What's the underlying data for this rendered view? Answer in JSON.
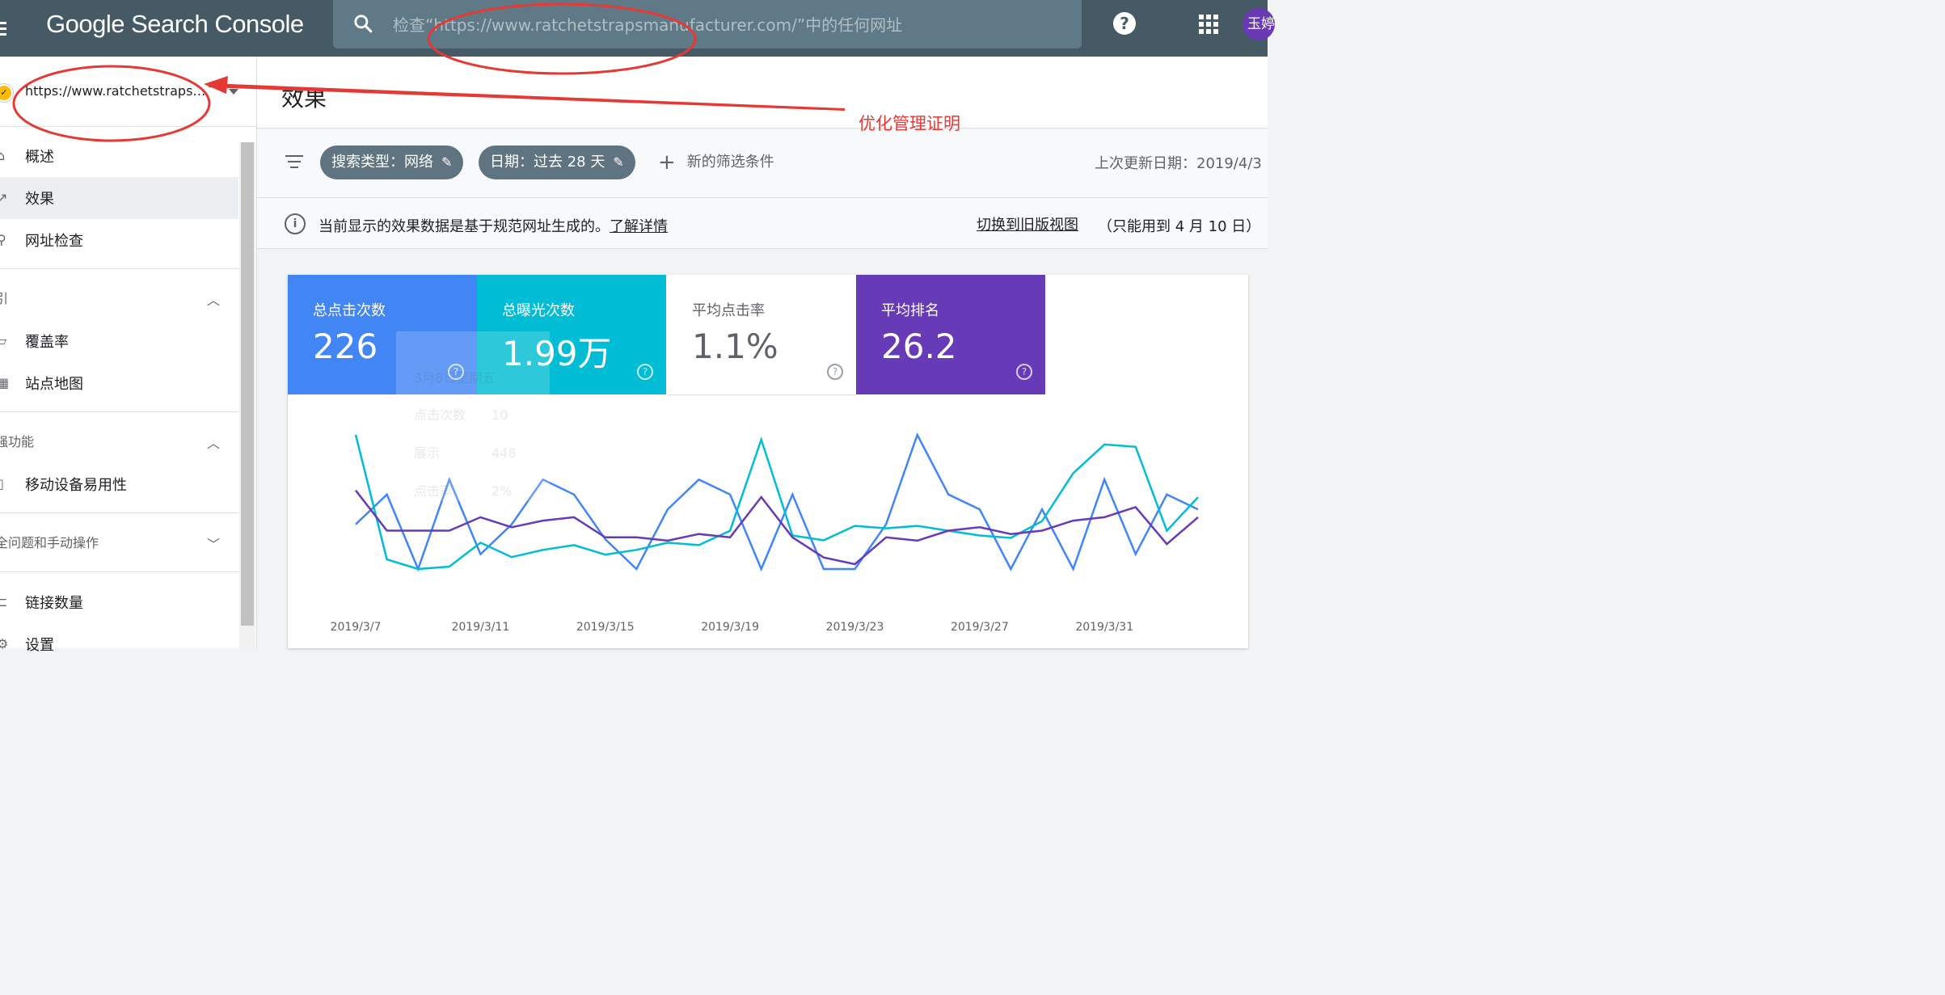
{
  "app": {
    "title": "Google Search Console"
  },
  "search": {
    "placeholder": "检查“https://www.ratchetstrapsmanufacturer.com/”中的任何网址"
  },
  "header": {
    "help_glyph": "?",
    "avatar_initials": "玉婷"
  },
  "sidebar": {
    "property": "https://www.ratchetstrapsmanufacturer.com/",
    "items": [
      {
        "label": "概述",
        "icon": "home-icon"
      },
      {
        "label": "效果",
        "icon": "trending-up-icon",
        "active": true
      },
      {
        "label": "网址检查",
        "icon": "search-icon"
      }
    ],
    "sections": [
      {
        "title": "索引",
        "shown": "引",
        "expanded": true,
        "items": [
          {
            "label": "覆盖率",
            "icon": "coverage-icon"
          },
          {
            "label": "站点地图",
            "icon": "sitemap-icon"
          }
        ]
      },
      {
        "title": "增强功能",
        "shown": "强功能",
        "expanded": true,
        "items": [
          {
            "label": "移动设备易用性",
            "icon": "phone-icon"
          }
        ]
      },
      {
        "title": "安全问题和手动操作",
        "shown": "全问题和手动操作",
        "expanded": false,
        "items": []
      }
    ],
    "bottom_items": [
      {
        "label": "链接数量",
        "icon": "links-icon"
      },
      {
        "label": "设置",
        "icon": "gear-icon"
      }
    ]
  },
  "page": {
    "title": "效果"
  },
  "filters": {
    "chips": [
      "搜索类型：网络",
      "日期：过去 28 天"
    ],
    "add_label": "新的筛选条件",
    "last_updated": "上次更新日期：2019/4/3"
  },
  "info": {
    "text": "当前显示的效果数据是基于规范网址生成的。",
    "learn_more": "了解详情",
    "legacy_link": "切换到旧版视图",
    "legacy_note": "（只能用到 4 月 10 日）"
  },
  "metrics": [
    {
      "label": "总点击次数",
      "value": "226",
      "color": "#4285f4"
    },
    {
      "label": "总曝光次数",
      "value": "1.99万",
      "color": "#00bcd4"
    },
    {
      "label": "平均点击率",
      "value": "1.1%",
      "color": "#ffffff"
    },
    {
      "label": "平均排名",
      "value": "26.2",
      "color": "#673ab7"
    }
  ],
  "tooltip": {
    "date": "3月8日星期五",
    "rows": [
      "点击次数　　10",
      "展示　　　　448",
      "点击率　　　2%"
    ]
  },
  "annotation": {
    "text": "优化管理证明"
  },
  "chart_data": {
    "type": "line",
    "x": [
      "2019/3/7",
      "2019/3/8",
      "2019/3/9",
      "2019/3/10",
      "2019/3/11",
      "2019/3/12",
      "2019/3/13",
      "2019/3/14",
      "2019/3/15",
      "2019/3/16",
      "2019/3/17",
      "2019/3/18",
      "2019/3/19",
      "2019/3/20",
      "2019/3/21",
      "2019/3/22",
      "2019/3/23",
      "2019/3/24",
      "2019/3/25",
      "2019/3/26",
      "2019/3/27",
      "2019/3/28",
      "2019/3/29",
      "2019/3/30",
      "2019/3/31",
      "2019/4/1",
      "2019/4/2",
      "2019/4/3"
    ],
    "tick_labels": [
      "2019/3/7",
      "2019/3/11",
      "2019/3/15",
      "2019/3/19",
      "2019/3/23",
      "2019/3/27",
      "2019/3/31"
    ],
    "series": [
      {
        "name": "总点击次数",
        "color": "#4285f4",
        "values": [
          8,
          10,
          5,
          11,
          6,
          8,
          11,
          10,
          7,
          5,
          9,
          11,
          10,
          5,
          10,
          5,
          5,
          8,
          14,
          10,
          9,
          5,
          9,
          5,
          11,
          6,
          10,
          9
        ]
      },
      {
        "name": "总曝光次数",
        "color": "#00bcd4",
        "values": [
          900,
          380,
          340,
          350,
          450,
          390,
          420,
          440,
          400,
          420,
          450,
          440,
          500,
          880,
          480,
          460,
          520,
          510,
          520,
          500,
          480,
          470,
          540,
          740,
          860,
          850,
          500,
          640
        ]
      },
      {
        "name": "平均排名",
        "color": "#673ab7",
        "values": [
          22,
          28,
          28,
          28,
          26,
          27.5,
          26.5,
          26,
          29,
          29,
          29.5,
          28.5,
          29,
          23,
          29,
          32,
          33,
          29,
          29.5,
          28,
          27.5,
          28.5,
          28,
          26.5,
          26,
          24.5,
          30,
          26
        ]
      }
    ],
    "grid": false,
    "legend": "none"
  }
}
